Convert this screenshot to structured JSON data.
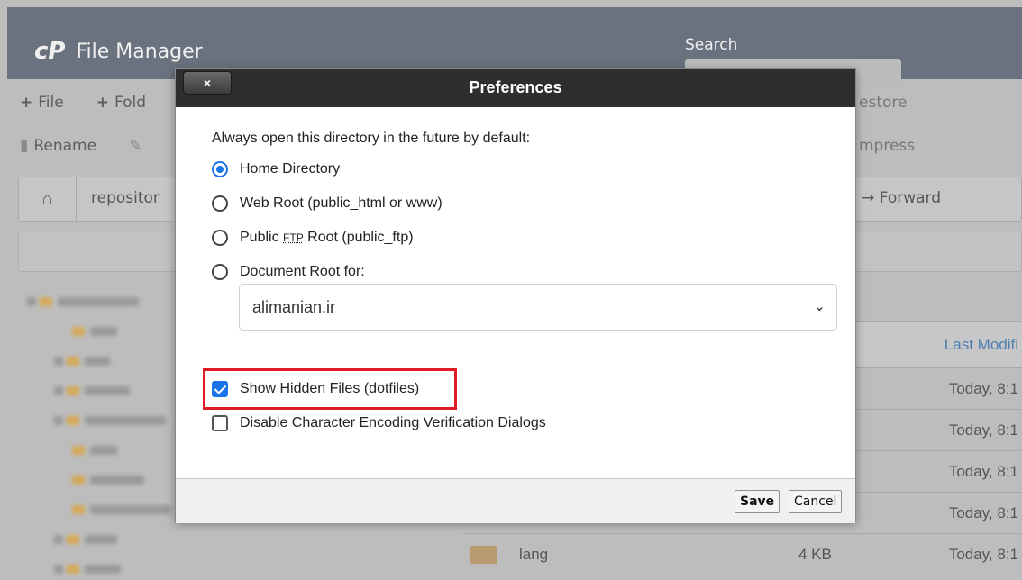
{
  "app": {
    "logo": "cP",
    "title": "File Manager",
    "search_label": "Search"
  },
  "toolbar": {
    "row1": [
      {
        "glyph": "+",
        "label": "File"
      },
      {
        "glyph": "+",
        "label": "Fold"
      }
    ],
    "row1_right": "estore",
    "row2": [
      {
        "glyph": "▮",
        "label": "Rename"
      },
      {
        "glyph": "✎",
        "label": ""
      }
    ],
    "row2_right": "mpress"
  },
  "pathbar": {
    "path": "repositor",
    "forward_label": "→ Forward"
  },
  "file_list": {
    "column_last_modified": "Last Modifi",
    "rows": [
      {
        "name": "",
        "size": "",
        "modified": "Today, 8:1"
      },
      {
        "name": "",
        "size": "",
        "modified": "Today, 8:1"
      },
      {
        "name": "",
        "size": "",
        "modified": "Today, 8:1"
      },
      {
        "name": "",
        "size": "",
        "modified": "Today, 8:1"
      },
      {
        "name": "lang",
        "size": "4 KB",
        "modified": "Today, 8:1"
      }
    ]
  },
  "modal": {
    "title": "Preferences",
    "close_label": "×",
    "intro": "Always open this directory in the future by default:",
    "options": {
      "home": "Home Directory",
      "webroot": "Web Root (public_html or www)",
      "ftp_prefix": "Public ",
      "ftp_abbr": "FTP",
      "ftp_suffix": " Root (public_ftp)",
      "docroot": "Document Root for:"
    },
    "selected_option": "home",
    "docroot_value": "alimanian.ir",
    "checkboxes": {
      "show_hidden": {
        "label": "Show Hidden Files (dotfiles)",
        "checked": true
      },
      "disable_encoding": {
        "label": "Disable Character Encoding Verification Dialogs",
        "checked": false
      }
    },
    "save_label": "Save",
    "cancel_label": "Cancel"
  },
  "colors": {
    "accent": "#1a73e8",
    "highlight": "#e01c24",
    "header_bg": "#2e2e2e",
    "topbar_bg": "#6a7280"
  }
}
